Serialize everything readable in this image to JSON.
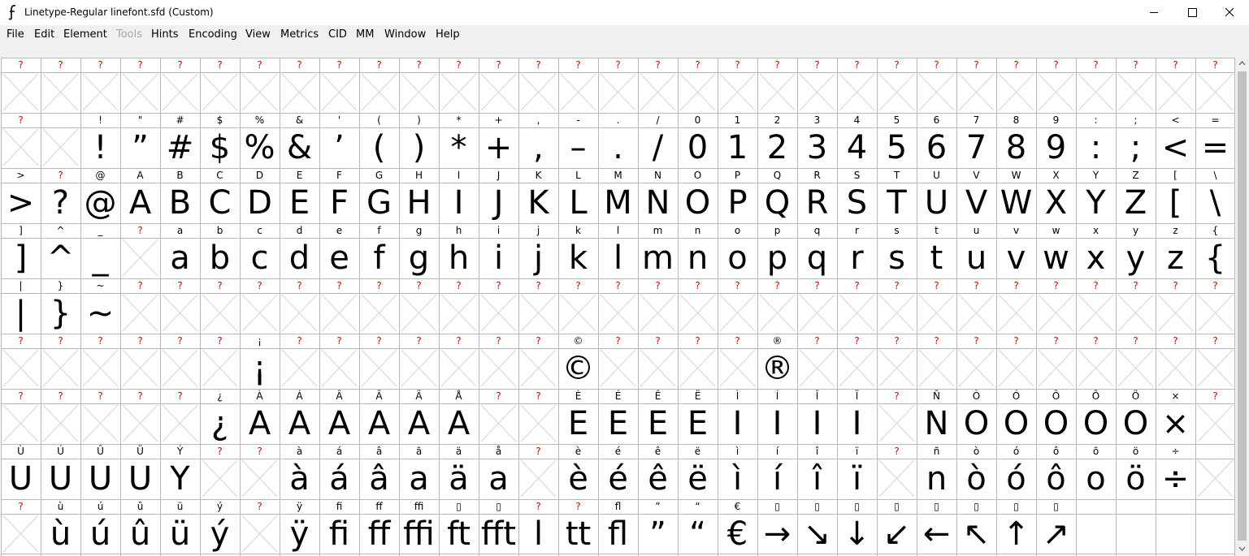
{
  "window": {
    "title": "Linetype-Regular  linefont.sfd (Custom)"
  },
  "menu": [
    "File",
    "Edit",
    "Element",
    "Tools",
    "Hints",
    "Encoding",
    "View",
    "Metrics",
    "CID",
    "MM",
    "Window",
    "Help"
  ],
  "menu_disabled": [
    "Tools"
  ],
  "grid": {
    "columns": 31,
    "rows": [
      {
        "labels": [
          "?",
          "?",
          "?",
          "?",
          "?",
          "?",
          "?",
          "?",
          "?",
          "?",
          "?",
          "?",
          "?",
          "?",
          "?",
          "?",
          "?",
          "?",
          "?",
          "?",
          "?",
          "?",
          "?",
          "?",
          "?",
          "?",
          "?",
          "?",
          "?",
          "?",
          "?"
        ],
        "glyphs": [
          "",
          "",
          "",
          "",
          "",
          "",
          "",
          "",
          "",
          "",
          "",
          "",
          "",
          "",
          "",
          "",
          "",
          "",
          "",
          "",
          "",
          "",
          "",
          "",
          "",
          "",
          "",
          "",
          "",
          "",
          ""
        ]
      },
      {
        "labels": [
          "?",
          "",
          "!",
          "\"",
          "#",
          "$",
          "%",
          "&",
          "'",
          "(",
          ")",
          "*",
          "+",
          ",",
          "-",
          ".",
          "/",
          "0",
          "1",
          "2",
          "3",
          "4",
          "5",
          "6",
          "7",
          "8",
          "9",
          ":",
          ";",
          "<",
          "="
        ],
        "glyphs": [
          "",
          "",
          "!",
          "”",
          "#",
          "$",
          "%",
          "&",
          "’",
          "(",
          ")",
          "*",
          "+",
          ",",
          "–",
          ".",
          "/",
          "0",
          "1",
          "2",
          "3",
          "4",
          "5",
          "6",
          "7",
          "8",
          "9",
          ":",
          ";",
          "<",
          "="
        ]
      },
      {
        "labels": [
          ">",
          "?",
          "@",
          "A",
          "B",
          "C",
          "D",
          "E",
          "F",
          "G",
          "H",
          "I",
          "J",
          "K",
          "L",
          "M",
          "N",
          "O",
          "P",
          "Q",
          "R",
          "S",
          "T",
          "U",
          "V",
          "W",
          "X",
          "Y",
          "Z",
          "[",
          "\\"
        ],
        "glyphs": [
          ">",
          "?",
          "@",
          "A",
          "B",
          "C",
          "D",
          "E",
          "F",
          "G",
          "H",
          "I",
          "J",
          "K",
          "L",
          "M",
          "N",
          "O",
          "P",
          "Q",
          "R",
          "S",
          "T",
          "U",
          "V",
          "W",
          "X",
          "Y",
          "Z",
          "[",
          "\\"
        ]
      },
      {
        "labels": [
          "]",
          "^",
          "_",
          "?",
          "a",
          "b",
          "c",
          "d",
          "e",
          "f",
          "g",
          "h",
          "i",
          "j",
          "k",
          "l",
          "m",
          "n",
          "o",
          "p",
          "q",
          "r",
          "s",
          "t",
          "u",
          "v",
          "w",
          "x",
          "y",
          "z",
          "{"
        ],
        "glyphs": [
          "]",
          "^",
          "_",
          "",
          "a",
          "b",
          "c",
          "d",
          "e",
          "f",
          "g",
          "h",
          "i",
          "j",
          "k",
          "l",
          "m",
          "n",
          "o",
          "p",
          "q",
          "r",
          "s",
          "t",
          "u",
          "v",
          "w",
          "x",
          "y",
          "z",
          "{"
        ]
      },
      {
        "labels": [
          "|",
          "}",
          "~",
          "?",
          "?",
          "?",
          "?",
          "?",
          "?",
          "?",
          "?",
          "?",
          "?",
          "?",
          "?",
          "?",
          "?",
          "?",
          "?",
          "?",
          "?",
          "?",
          "?",
          "?",
          "?",
          "?",
          "?",
          "?",
          "?",
          "?",
          "?"
        ],
        "glyphs": [
          "|",
          "}",
          "~",
          "",
          "",
          "",
          "",
          "",
          "",
          "",
          "",
          "",
          "",
          "",
          "",
          "",
          "",
          "",
          "",
          "",
          "",
          "",
          "",
          "",
          "",
          "",
          "",
          "",
          "",
          "",
          ""
        ]
      },
      {
        "labels": [
          "?",
          "?",
          "?",
          "?",
          "?",
          "?",
          "¡",
          "?",
          "?",
          "?",
          "?",
          "?",
          "?",
          "?",
          "©",
          "?",
          "?",
          "?",
          "?",
          "®",
          "?",
          "?",
          "?",
          "?",
          "?",
          "?",
          "?",
          "?",
          "?",
          "?",
          "?"
        ],
        "glyphs": [
          "",
          "",
          "",
          "",
          "",
          "",
          "¡",
          "",
          "",
          "",
          "",
          "",
          "",
          "",
          "©",
          "",
          "",
          "",
          "",
          "®",
          "",
          "",
          "",
          "",
          "",
          "",
          "",
          "",
          "",
          "",
          ""
        ]
      },
      {
        "labels": [
          "?",
          "?",
          "?",
          "?",
          "?",
          "¿",
          "À",
          "Á",
          "Â",
          "Ã",
          "Ä",
          "Å",
          "?",
          "?",
          "È",
          "É",
          "Ê",
          "Ë",
          "Ì",
          "Í",
          "Î",
          "Ï",
          "?",
          "Ñ",
          "Ò",
          "Ó",
          "Ô",
          "Õ",
          "Ö",
          "×",
          "?"
        ],
        "glyphs": [
          "",
          "",
          "",
          "",
          "",
          "¿",
          "A",
          "A",
          "A",
          "A",
          "A",
          "A",
          "",
          "",
          "E",
          "E",
          "E",
          "E",
          "I",
          "I",
          "I",
          "I",
          "",
          "N",
          "O",
          "O",
          "O",
          "O",
          "O",
          "×",
          ""
        ]
      },
      {
        "labels": [
          "Ù",
          "Ú",
          "Û",
          "Ü",
          "Ý",
          "?",
          "?",
          "à",
          "á",
          "â",
          "ã",
          "ä",
          "å",
          "?",
          "è",
          "é",
          "ê",
          "ë",
          "ì",
          "í",
          "î",
          "ï",
          "?",
          "ñ",
          "ò",
          "ó",
          "ô",
          "õ",
          "ö",
          "÷",
          ""
        ],
        "glyphs": [
          "U",
          "U",
          "U",
          "U",
          "Y",
          "",
          "",
          "à",
          "á",
          "â",
          "a",
          "ä",
          "a",
          "",
          "è",
          "é",
          "ê",
          "ë",
          "ì",
          "í",
          "î",
          "ï",
          "",
          "n",
          "ò",
          "ó",
          "ô",
          "o",
          "ö",
          "÷",
          ""
        ]
      },
      {
        "labels": [
          "?",
          "ù",
          "ú",
          "û",
          "ü",
          "ý",
          "?",
          "ÿ",
          "ﬁ",
          "ﬀ",
          "ﬃ",
          "▯",
          "▯",
          "?",
          "?",
          "ﬂ",
          "”",
          "“",
          "€",
          "▯",
          "▯",
          "▯",
          "▯",
          "▯",
          "▯",
          "▯",
          "▯",
          "",
          "",
          "",
          ""
        ],
        "glyphs": [
          "",
          "ù",
          "ú",
          "û",
          "ü",
          "ý",
          "",
          "ÿ",
          "fi",
          "ff",
          "ffi",
          "ft",
          "fft",
          "l",
          "tt",
          "fl",
          "”",
          "“",
          "€",
          "→",
          "↘",
          "↓",
          "↙",
          "←",
          "↖",
          "↑",
          "↗",
          "",
          "",
          "",
          ""
        ]
      }
    ]
  },
  "colors": {
    "grid_line": "#b8b8b8",
    "placeholder_cross": "#d4d4d4",
    "missing_label": "#e00000",
    "label": "#000000"
  },
  "icons": {
    "app": "fontforge-icon",
    "minimize": "minimize-icon",
    "maximize": "maximize-icon",
    "close": "close-icon"
  }
}
